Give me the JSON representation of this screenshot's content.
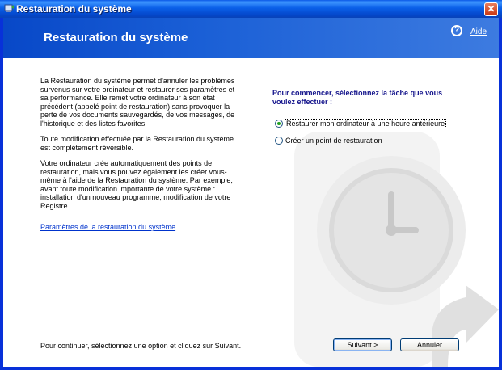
{
  "window": {
    "title": "Restauration du système",
    "close_label": "✕"
  },
  "banner": {
    "title": "Restauration du système",
    "help_label": "Aide",
    "help_icon_glyph": "?"
  },
  "description": {
    "paragraphs": [
      "La Restauration du système permet d'annuler les problèmes survenus sur votre ordinateur et restaurer ses paramètres et sa performance. Elle remet votre ordinateur à son état précédent (appelé point de restauration) sans provoquer la perte de vos documents sauvegardés, de vos messages, de l'historique et des listes favorites.",
      "Toute modification effectuée par la Restauration du système est complètement réversible.",
      "Votre ordinateur crée automatiquement des points de restauration, mais vous pouvez également les créer vous-même à l'aide de la Restauration du système. Par exemple, avant toute modification importante de votre système : installation d'un nouveau programme, modification de votre Registre."
    ],
    "settings_link": "Paramètres de la restauration du système"
  },
  "tasks": {
    "prompt": "Pour commencer, sélectionnez la tâche que vous voulez effectuer :",
    "options": [
      {
        "label": "Restaurer mon ordinateur à une heure antérieure",
        "selected": true
      },
      {
        "label": "Créer un point de restauration",
        "selected": false
      }
    ]
  },
  "footer": {
    "instruction": "Pour continuer, sélectionnez une option et cliquez sur Suivant.",
    "next_label": "Suivant >",
    "cancel_label": "Annuler"
  },
  "colors": {
    "titlebar": "#0a5fe8",
    "banner": "#1a5fd6",
    "divider": "#1b3fb8",
    "prompt_text": "#14148c",
    "link": "#0033cc"
  },
  "icons": {
    "title_icon": "system-restore-icon",
    "help_icon": "help-icon",
    "watermark": "clock-arrow-watermark"
  }
}
